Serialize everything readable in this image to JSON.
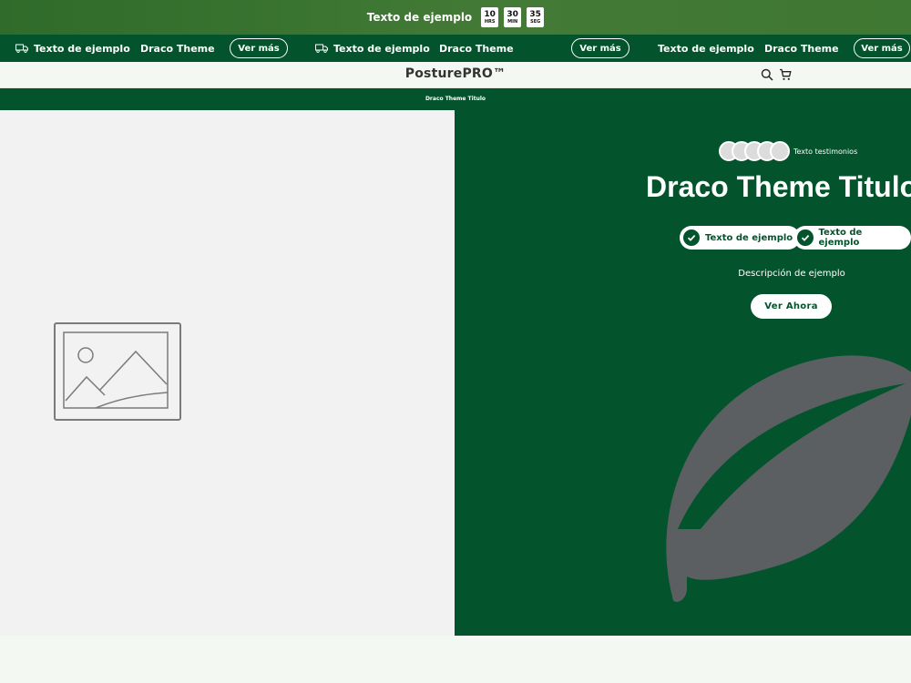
{
  "countdown": {
    "text": "Texto de ejemplo",
    "timers": [
      {
        "value": "10",
        "unit": "HRS"
      },
      {
        "value": "30",
        "unit": "MIN"
      },
      {
        "value": "35",
        "unit": "SEG"
      }
    ]
  },
  "marquee": {
    "item_text": "Texto de ejemplo",
    "theme_text": "Draco Theme",
    "button_label": "Ver más"
  },
  "header": {
    "logo": "PosturePRO™"
  },
  "subtitle_bar": {
    "text": "Draco Theme Titulo"
  },
  "hero": {
    "testimonials_text": "Texto testimonios",
    "title": "Draco Theme Titulo",
    "badges": [
      "Texto de ejemplo",
      "Texto de ejemplo"
    ],
    "description": "Descripción de ejemplo",
    "cta_label": "Ver Ahora"
  },
  "colors": {
    "brand_green": "#03542c",
    "countdown_green": "#3f7832",
    "leaf_gray": "#5c5f62"
  },
  "icons": [
    "truck-icon",
    "search-icon",
    "cart-icon",
    "check-icon",
    "image-placeholder-icon",
    "leaf-icon"
  ]
}
